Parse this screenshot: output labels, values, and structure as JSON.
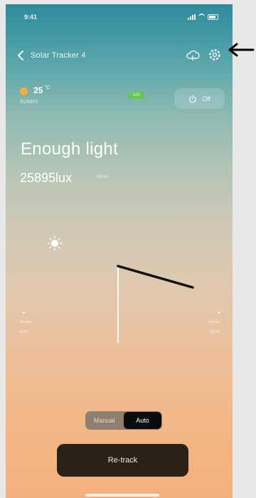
{
  "status": {
    "time": "9:41"
  },
  "nav": {
    "title": "Solar Tracker 4",
    "icons": [
      "back-icon",
      "cloud-icon",
      "gear-icon"
    ]
  },
  "weather": {
    "temperature": "25",
    "unit": "°C",
    "condition": "SUNNY"
  },
  "device_battery": {
    "label": "100"
  },
  "power": {
    "label": "Off"
  },
  "light": {
    "status": "Enough light",
    "lux": "25895lux",
    "tag": "Good"
  },
  "markers": {
    "left": {
      "label": "Sunrise",
      "value": "6:10"
    },
    "right": {
      "label": "Sunset",
      "value": "18:30"
    }
  },
  "mode": {
    "options": [
      "Manual",
      "Auto"
    ],
    "selected": "Auto"
  },
  "retrack": {
    "label": "Re-track"
  },
  "colors": {
    "gradient_top": "#2d8a9d",
    "gradient_bottom": "#f4b07c",
    "button_dark": "#2a2219",
    "battery_green": "#63c84c",
    "sun_orange": "#f5b234"
  }
}
